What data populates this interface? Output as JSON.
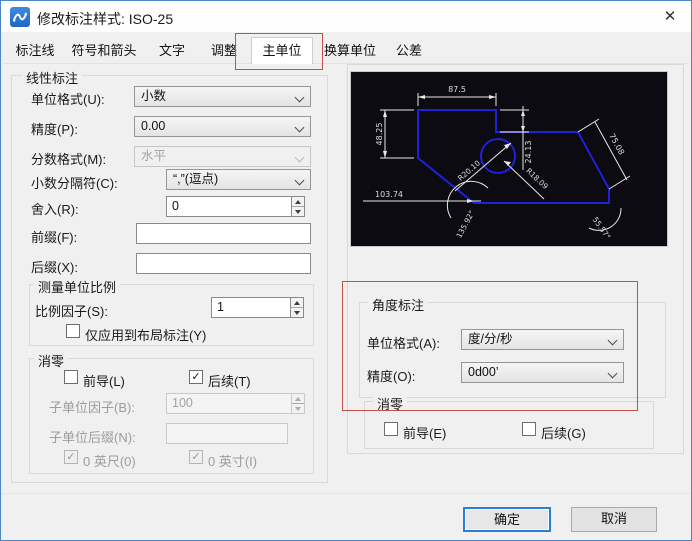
{
  "window": {
    "title": "修改标注样式: ISO-25",
    "close_glyph": "✕"
  },
  "tabs": [
    {
      "label": "标注线"
    },
    {
      "label": "符号和箭头"
    },
    {
      "label": "文字"
    },
    {
      "label": "调整"
    },
    {
      "label": "主单位"
    },
    {
      "label": "换算单位"
    },
    {
      "label": "公差"
    }
  ],
  "active_tab": "主单位",
  "linear": {
    "title": "线性标注",
    "unit_format_label": "单位格式(U):",
    "unit_format_value": "小数",
    "precision_label": "精度(P):",
    "precision_value": "0.00",
    "fraction_label": "分数格式(M):",
    "fraction_value": "水平",
    "decimal_sep_label": "小数分隔符(C):",
    "decimal_sep_value": "“,”(逗点)",
    "round_label": "舍入(R):",
    "round_value": "0",
    "prefix_label": "前缀(F):",
    "prefix_value": "",
    "suffix_label": "后缀(X):",
    "suffix_value": ""
  },
  "measure_scale": {
    "title": "测量单位比例",
    "factor_label": "比例因子(S):",
    "factor_value": "1",
    "layout_only_label": "仅应用到布局标注(Y)",
    "layout_only_check": ""
  },
  "zero_left": {
    "title": "消零",
    "leading_label": "前导(L)",
    "leading_check": "",
    "trailing_label": "后续(T)",
    "trailing_check": "✓",
    "sub_factor_label": "子单位因子(B):",
    "sub_factor_value": "100",
    "sub_suffix_label": "子单位后缀(N):",
    "sub_suffix_value": "",
    "feet_label": "0 英尺(0)",
    "feet_check": "✓",
    "inch_label": "0 英寸(I)",
    "inch_check": "✓"
  },
  "preview_dims": {
    "top": "87.5",
    "left": "48.25",
    "step": "24.13",
    "aligned": "75.08",
    "bottom": "103.74",
    "radius_left": "R20.10",
    "radius_right": "R18.09",
    "angle_left": "135.92°",
    "angle_right": "55.57°"
  },
  "angular": {
    "title": "角度标注",
    "unit_format_label": "单位格式(A):",
    "unit_format_value": "度/分/秒",
    "precision_label": "精度(O):",
    "precision_value": "0d00’"
  },
  "zero_right": {
    "title": "消零",
    "leading_label": "前导(E)",
    "leading_check": "",
    "trailing_label": "后续(G)",
    "trailing_check": ""
  },
  "buttons": {
    "ok": "确定",
    "cancel": "取消"
  },
  "colors": {
    "annotation_red": "#c0524b",
    "focus_blue": "#2a7fd4",
    "cad_blue": "#2020d6",
    "preview_bg": "#0b0b11"
  }
}
